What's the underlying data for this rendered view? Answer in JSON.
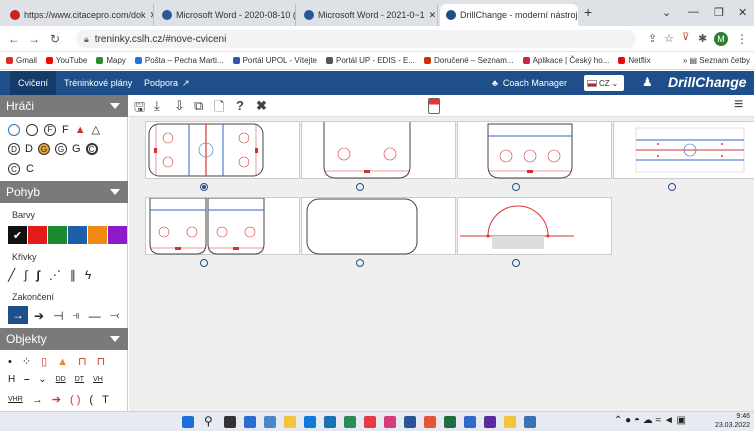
{
  "browser": {
    "tabs": [
      {
        "label": "https://www.citacepro.com/dok",
        "icon_color": "#cc2222"
      },
      {
        "label": "Microsoft Word - 2020-08-10 (1",
        "icon_color": "#2b579a"
      },
      {
        "label": "Microsoft Word - 2021-0~1",
        "icon_color": "#2b579a"
      },
      {
        "label": "DrillChange - moderní nástroj pr",
        "icon_color": "#1f4f8a"
      }
    ],
    "new_tab": "+",
    "url": "treninky.cslh.cz/#nove-cviceni",
    "bookmarks": [
      {
        "label": "Gmail",
        "color": "#d93025"
      },
      {
        "label": "YouTube",
        "color": "#ff0000"
      },
      {
        "label": "Mapy",
        "color": "#2a8c2a"
      },
      {
        "label": "Pošta – Pecha Marti...",
        "color": "#1a73e8"
      },
      {
        "label": "Portál UPOL - Vítejte",
        "color": "#3355aa"
      },
      {
        "label": "Portál UP - EDIS - E...",
        "color": "#555555"
      },
      {
        "label": "Doručené – Seznam...",
        "color": "#cc3300"
      },
      {
        "label": "Aplikace | Český ho...",
        "color": "#cc2244"
      },
      {
        "label": "Netflix",
        "color": "#e50914"
      }
    ],
    "reading_list": "Seznam četby",
    "profile_letter": "M"
  },
  "appnav": {
    "items": [
      "Cvičení",
      "Tréninkové plány",
      "Podpora"
    ],
    "coach_manager": "Coach Manager",
    "lang": "CZ",
    "brand": "DrillChange"
  },
  "sidebar": {
    "players_title": "Hráči",
    "players_row1": [
      "F",
      "F"
    ],
    "players_row2": [
      "D",
      "D",
      "G",
      "G",
      "G",
      "C"
    ],
    "players_row3": [
      "C",
      "C"
    ],
    "movement_title": "Pohyb",
    "colors_label": "Barvy",
    "colors": [
      "#111111",
      "#e21b1b",
      "#1c8a2e",
      "#1f5fa8",
      "#f08a14",
      "#8b1bc6"
    ],
    "curves_label": "Křivky",
    "endings_label": "Zakončení",
    "objects_title": "Objekty",
    "obj_row2": [
      "H",
      "DD",
      "DT",
      "VH"
    ],
    "obj_row3": [
      "VHR",
      "( )",
      "(",
      "T"
    ]
  },
  "drills": [
    {
      "selected": true
    },
    {
      "selected": false
    },
    {
      "selected": false
    },
    {
      "selected": false
    },
    {
      "selected": false
    },
    {
      "selected": false
    },
    {
      "selected": false
    }
  ],
  "taskbar": {
    "time": "9:46",
    "date": "23.03.2022"
  }
}
